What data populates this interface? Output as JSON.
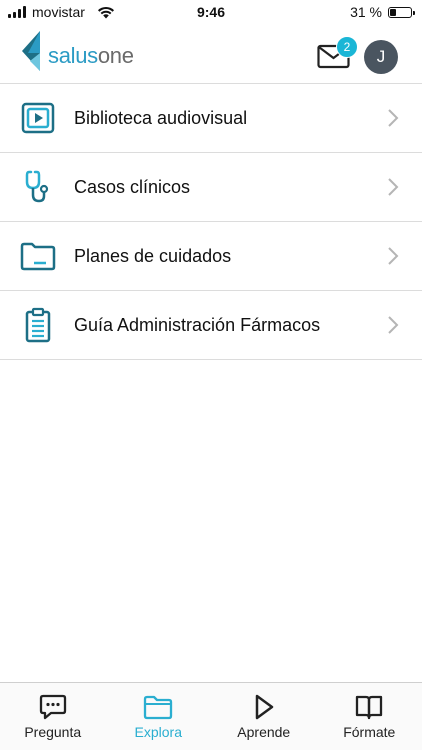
{
  "status_bar": {
    "carrier": "movistar",
    "time": "9:46",
    "battery_percent": "31 %",
    "battery_level": 0.31
  },
  "header": {
    "logo": {
      "part1": "salus",
      "part2": "one"
    },
    "mail_badge": "2",
    "avatar_initial": "J"
  },
  "menu": [
    {
      "label": "Biblioteca audiovisual",
      "icon": "video-library-icon"
    },
    {
      "label": "Casos clínicos",
      "icon": "stethoscope-icon"
    },
    {
      "label": "Planes de cuidados",
      "icon": "folder-icon"
    },
    {
      "label": "Guía Administración Fármacos",
      "icon": "clipboard-icon"
    }
  ],
  "tabs": [
    {
      "label": "Pregunta",
      "icon": "chat-icon",
      "active": false
    },
    {
      "label": "Explora",
      "icon": "folder-icon",
      "active": true
    },
    {
      "label": "Aprende",
      "icon": "play-icon",
      "active": false
    },
    {
      "label": "Fórmate",
      "icon": "book-icon",
      "active": false
    }
  ],
  "colors": {
    "accent": "#2aaed0",
    "brand_dark": "#1d6f86",
    "badge": "#1ab6d6",
    "avatar_bg": "#4a5560"
  }
}
